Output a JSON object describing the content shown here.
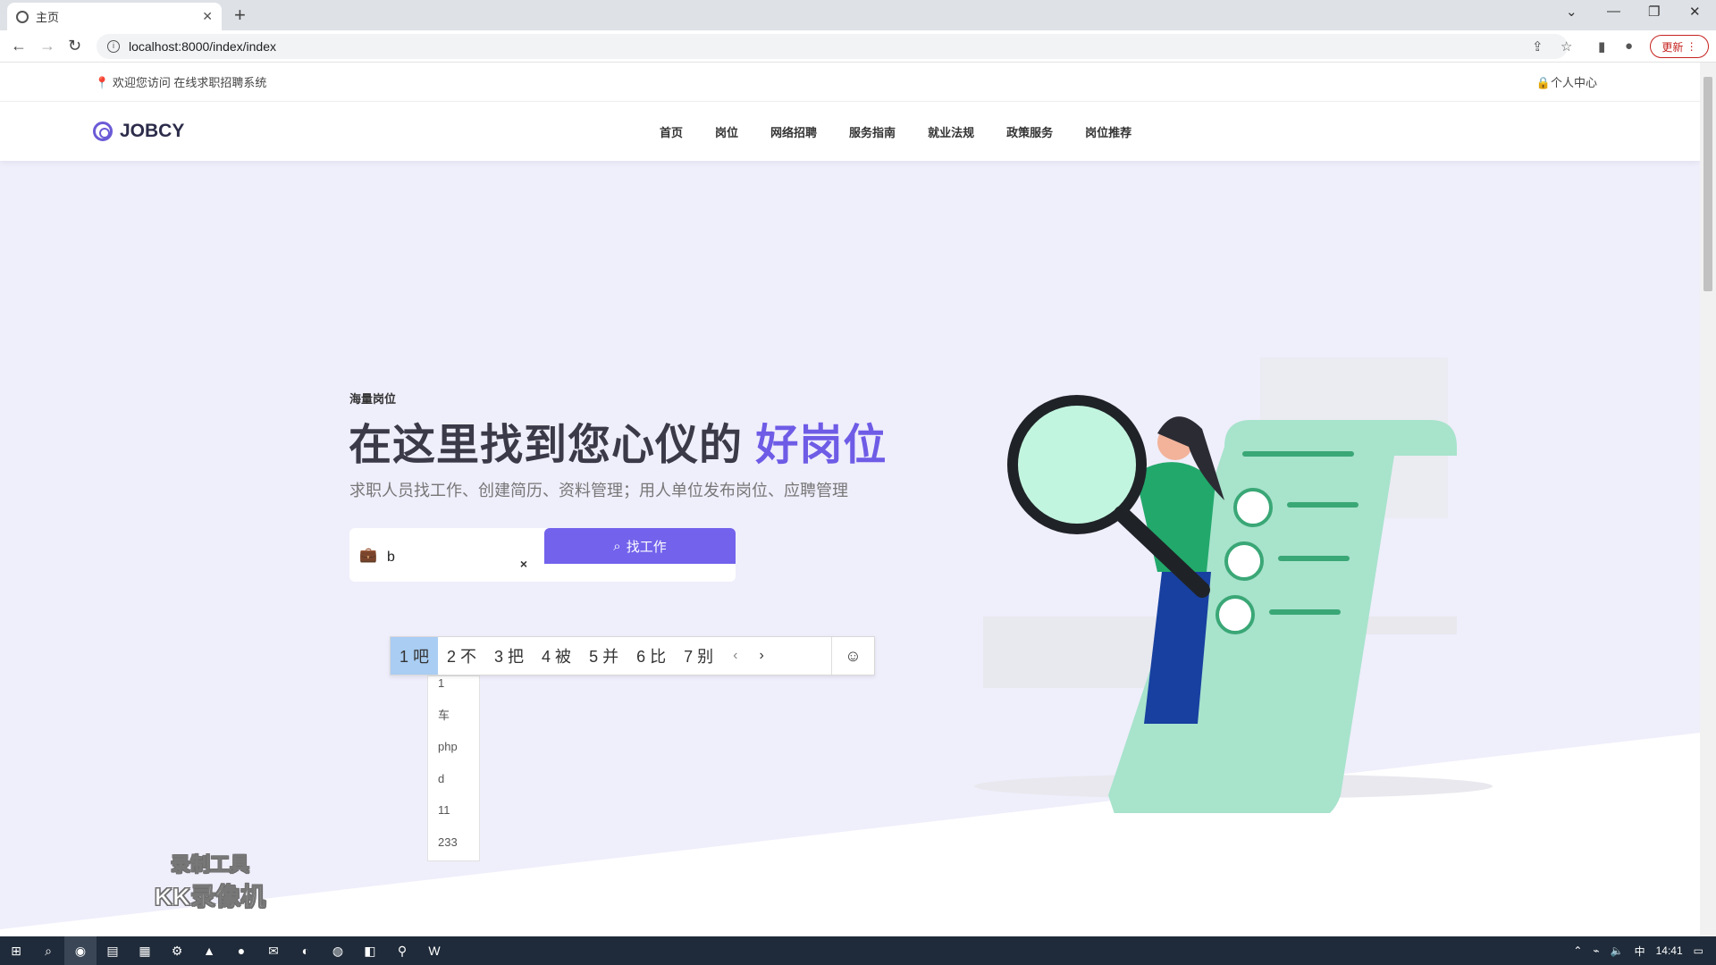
{
  "browser": {
    "tab_title": "主页",
    "new_tab": "+",
    "url": "localhost:8000/index/index",
    "update_label": "更新"
  },
  "page": {
    "topbar": {
      "welcome": "欢迎您访问 在线求职招聘系统",
      "user_center": "个人中心"
    },
    "logo": "JOBCY",
    "nav": [
      "首页",
      "岗位",
      "网络招聘",
      "服务指南",
      "就业法规",
      "政策服务",
      "岗位推荐"
    ],
    "hero": {
      "eyebrow": "海量岗位",
      "headline_main": "在这里找到您心仪的",
      "headline_highlight": "好岗位",
      "subline": "求职人员找工作、创建简历、资料管理；用人单位发布岗位、应聘管理"
    },
    "search": {
      "value": "b",
      "clear": "×",
      "button": "找工作"
    },
    "ime": {
      "candidates": [
        "1 吧",
        "2 不",
        "3 把",
        "4 被",
        "5 并",
        "6 比",
        "7 别"
      ],
      "selected_index": 0
    },
    "history": [
      "1",
      "车",
      "php",
      "d",
      "11",
      "233"
    ],
    "watermark": {
      "line1": "录制工具",
      "line2": "KK录像机"
    }
  },
  "taskbar": {
    "ime_mode": "中",
    "time": "14:41"
  },
  "colors": {
    "accent": "#7262ec",
    "hero_bg": "#efeefb",
    "illustration_green": "#a8e3cc"
  }
}
